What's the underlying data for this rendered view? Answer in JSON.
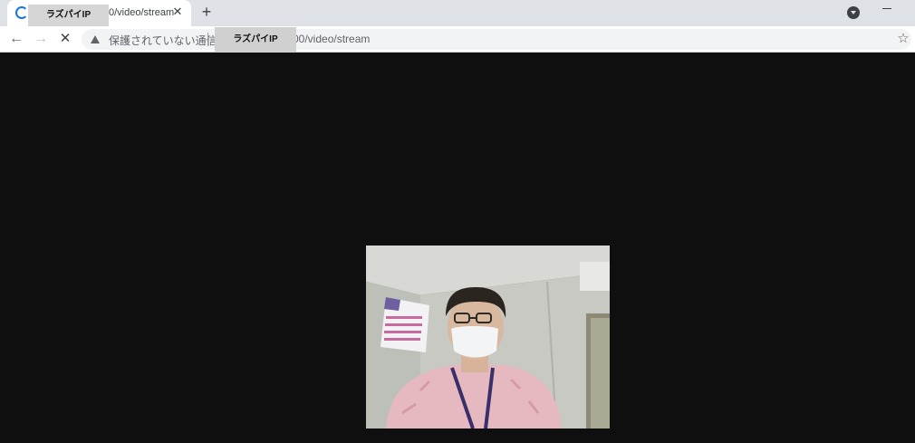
{
  "tab": {
    "title": "0/video/stream",
    "close_label": "✕",
    "new_tab_label": "+"
  },
  "redaction": {
    "tab_label": "ラズパイIP",
    "url_label": "ラズパイIP"
  },
  "toolbar": {
    "back_label": "←",
    "forward_label": "→",
    "stop_label": "✕",
    "security_text": "保護されていない通信",
    "url_text": "00/video/stream",
    "bookmark_label": "☆"
  },
  "icons": {
    "tab_loading": "loading-spinner-icon",
    "tab_search": "tab-search-icon",
    "minimize": "minimize-icon",
    "back": "arrow-left-icon",
    "forward": "arrow-right-icon",
    "stop": "close-icon",
    "warning": "warning-triangle-icon",
    "bookmark": "star-icon"
  },
  "colors": {
    "page_background": "#0f0f0f",
    "tabstrip": "#dee1e6",
    "spinner": "#1a73e8"
  },
  "content": {
    "type": "mjpeg-video-stream"
  }
}
